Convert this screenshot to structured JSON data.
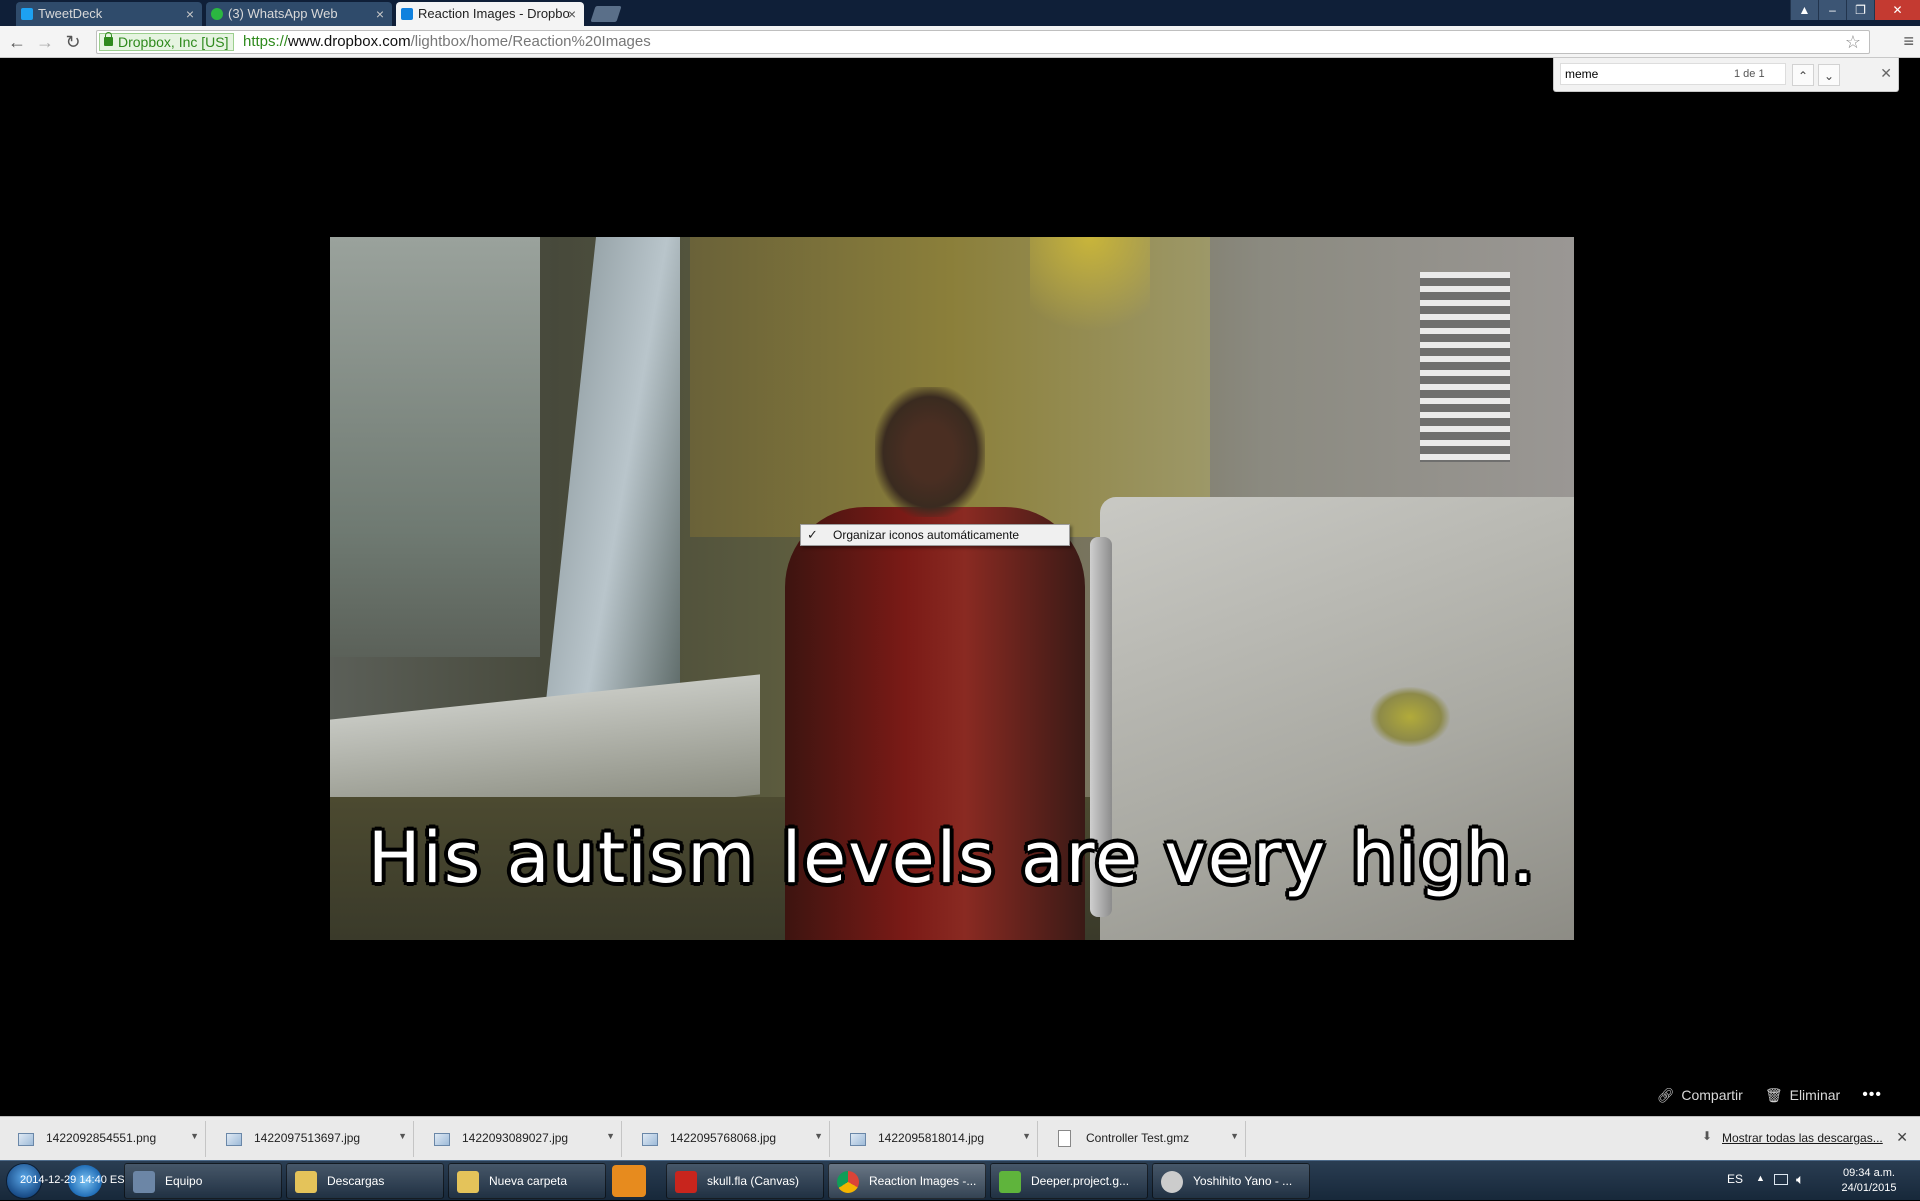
{
  "browser": {
    "tabs": [
      {
        "label": "TweetDeck",
        "icon": "twitter-icon",
        "color": "#1da1f2"
      },
      {
        "label": "(3) WhatsApp Web",
        "icon": "whatsapp-icon",
        "color": "#2bb741"
      },
      {
        "label": "Reaction Images - Dropbo",
        "icon": "dropbox-icon",
        "color": "#1081de"
      }
    ],
    "security_label": "Dropbox, Inc [US]",
    "url": {
      "scheme": "https://",
      "host": "www.dropbox.com",
      "path": "/lightbox/home/Reaction%20Images"
    }
  },
  "find_bar": {
    "query": "meme",
    "count": "1 de 1"
  },
  "lightbox": {
    "caption": "His autism levels are very high.",
    "actions": {
      "share": "Compartir",
      "delete": "Eliminar"
    }
  },
  "context_menu": {
    "check": "✓",
    "item": "Organizar iconos automáticamente"
  },
  "downloads": {
    "items": [
      {
        "name": "1422092854551.png"
      },
      {
        "name": "1422097513697.jpg"
      },
      {
        "name": "1422093089027.jpg"
      },
      {
        "name": "1422095768068.jpg"
      },
      {
        "name": "1422095818014.jpg"
      },
      {
        "name": "Controller Test.gmz"
      }
    ],
    "show_all": "Mostrar todas las descargas...",
    "overlay_text": "2014-12-29 14:40 ES"
  },
  "taskbar": {
    "items": [
      {
        "label": "Equipo",
        "color": "#6c86a6"
      },
      {
        "label": "Descargas",
        "color": "#e4c35a"
      },
      {
        "label": "Nueva carpeta",
        "color": "#e4c35a"
      },
      {
        "label": "skull.fla (Canvas)",
        "color": "#c8251d"
      },
      {
        "label": "Reaction Images -...",
        "color": "#db4437"
      },
      {
        "label": "Deeper.project.g...",
        "color": "#5fb43c"
      },
      {
        "label": "Yoshihito Yano - ...",
        "color": "#cccccc"
      }
    ],
    "tray": {
      "lang": "ES",
      "time": "09:34 a.m.",
      "date": "24/01/2015"
    }
  }
}
